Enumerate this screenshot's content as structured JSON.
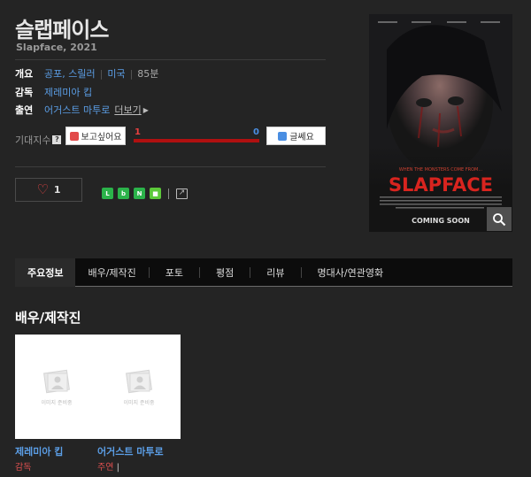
{
  "movie": {
    "title": "슬랩페이스",
    "original_title_year": "Slapface, 2021"
  },
  "info": {
    "overview_label": "개요",
    "genre": "공포, 스릴러",
    "country": "미국",
    "runtime": "85분",
    "director_label": "감독",
    "director": "제레미아 킵",
    "cast_label": "출연",
    "cast": "어거스트 마투로",
    "more_label": "더보기"
  },
  "anticipation": {
    "label": "기대지수",
    "help_icon": "?",
    "want_label": "보고싶어요",
    "want_count": "1",
    "nope_count": "0",
    "nope_label": "글쎄요",
    "want_ratio": 1.0,
    "colors": {
      "want": "#b01010",
      "nope": "#4a8ee2"
    }
  },
  "like": {
    "count": "1"
  },
  "share": {
    "icons": [
      "line-icon",
      "band-icon",
      "bookmark-icon",
      "note-icon",
      "share-icon"
    ]
  },
  "poster": {
    "tagline": "WHEN THE MONSTERS COME FROM...",
    "title": "SLAPFACE",
    "footer": "COMING SOON"
  },
  "tabs": [
    {
      "label": "주요정보",
      "active": true
    },
    {
      "label": "배우/제작진",
      "active": false
    },
    {
      "label": "포토",
      "active": false
    },
    {
      "label": "평점",
      "active": false
    },
    {
      "label": "리뷰",
      "active": false
    },
    {
      "label": "명대사/연관영화",
      "active": false
    }
  ],
  "cast_section": {
    "title": "배우/제작진",
    "placeholder_text": "이미지 준비중",
    "people": [
      {
        "name": "제레미아 킵",
        "role": "감독"
      },
      {
        "name": "어거스트 마투로",
        "role": "주연"
      }
    ]
  }
}
